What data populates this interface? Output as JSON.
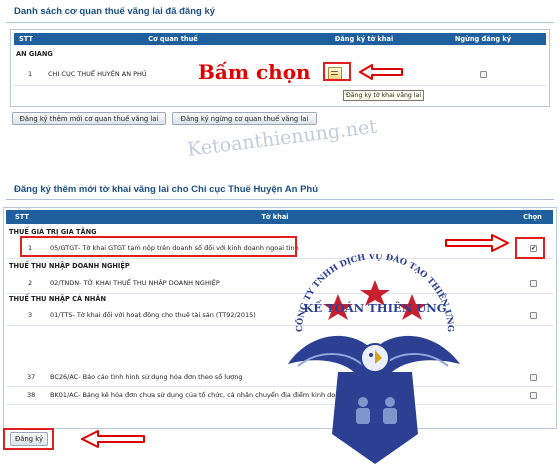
{
  "top_section": {
    "title": "Danh sách cơ quan thuế vãng lai đã đăng ký",
    "headers": {
      "stt": "STT",
      "agency": "Cơ quan thuế",
      "register": "Đăng ký tờ khai",
      "stop": "Ngừng đăng ký"
    },
    "group": "AN GIANG",
    "row": {
      "stt": "1",
      "agency": "CHI CỤC THUẾ HUYỆN AN PHÚ"
    },
    "tooltip": "Đăng ký tờ khai vãng lai",
    "btn_add": "Đăng ký thêm mới cơ quan thuế vãng lai",
    "btn_stop": "Đăng ký ngừng cơ quan thuế vãng lai"
  },
  "annotation": {
    "text": "Bấm chọn"
  },
  "watermark": {
    "text": "Ketoanthienung.net"
  },
  "bottom_section": {
    "title": "Đăng ký thêm mới tờ khai vãng lai cho Chi cục Thuế Huyện An Phú",
    "headers": {
      "stt": "STT",
      "form": "Tờ khai",
      "select": "Chọn"
    },
    "groups": [
      {
        "label": "THUẾ GIÁ TRỊ GIA TĂNG"
      },
      {
        "label": "THUẾ THU NHẬP DOANH NGHIỆP"
      },
      {
        "label": "THUẾ THU NHẬP CÁ NHÂN"
      }
    ],
    "rows": [
      {
        "stt": "1",
        "code": "05/GTGT",
        "desc": " - Tờ khai GTGT tạm nộp trên doanh số đối với kinh doanh ngoại tỉnh",
        "checked": true
      },
      {
        "stt": "2",
        "code": "02/TNDN",
        "desc": " - TỜ KHAI THUẾ THU NHẬP DOANH NGHIỆP",
        "checked": false
      },
      {
        "stt": "3",
        "code": "01/TTS",
        "desc": " - Tờ khai đối với hoạt động cho thuê tài sản (TT92/2015)",
        "checked": false
      },
      {
        "stt": "37",
        "code": "BC26/AC",
        "desc": " - Báo cáo tình hình sử dụng hóa đơn theo số lượng",
        "checked": false
      },
      {
        "stt": "38",
        "code": "BK01/AC",
        "desc": " - Bảng kê hóa đơn chưa sử dụng của tổ chức, cá nhân chuyển địa điểm kinh doanh khỏi",
        "checked": false
      }
    ],
    "submit": "Đăng ký"
  },
  "logo": {
    "arc_text": "CÔNG TY TNHH DỊCH VỤ ĐÀO TẠO THIÊN ƯNG",
    "brand": "KẾ TOÁN THIÊN ƯNG"
  },
  "colors": {
    "header_blue": "#1f5f9e",
    "title_blue": "#1b4f87",
    "annotation_red": "#e00000",
    "logo_blue": "#2b3f93",
    "logo_star_red": "#c8202c"
  }
}
